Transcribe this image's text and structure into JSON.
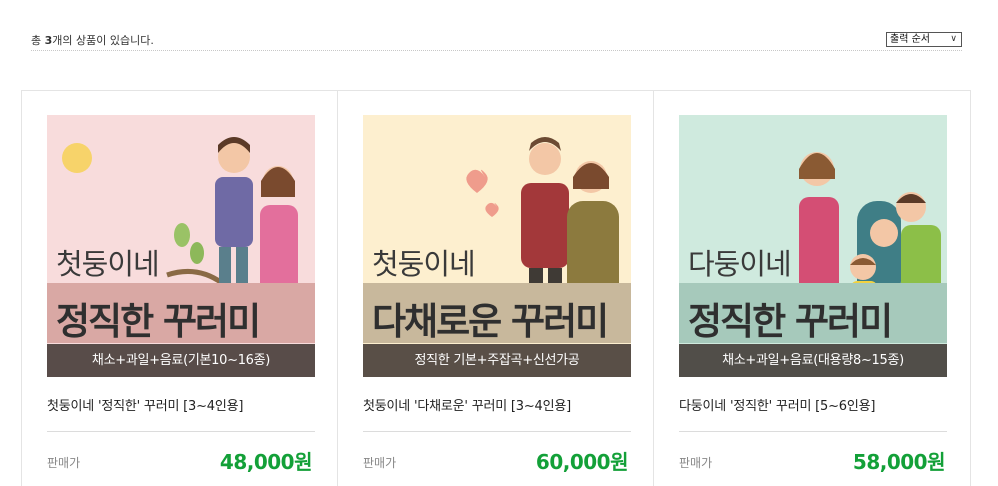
{
  "header": {
    "count_prefix": "총 ",
    "count": "3",
    "count_suffix": "개의 상품이 있습니다.",
    "sort_label": "출력 순서"
  },
  "products": [
    {
      "brand": "첫둥이네",
      "headline": "정직한 꾸러미",
      "caption": "채소+과일+음료(기본10~16종)",
      "name": "첫둥이네 '정직한' 꾸러미 [3~4인용]",
      "price_label": "판매가",
      "price": "48,000원",
      "bg_color": "#f8dcdc",
      "band_color": "#d9a8a4"
    },
    {
      "brand": "첫둥이네",
      "headline": "다채로운 꾸러미",
      "caption": "정직한 기본+주잡곡+신선가공",
      "name": "첫둥이네 '다채로운' 꾸러미 [3~4인용]",
      "price_label": "판매가",
      "price": "60,000원",
      "bg_color": "#fdefcf",
      "band_color": "#c8b89c"
    },
    {
      "brand": "다둥이네",
      "headline": "정직한 꾸러미",
      "caption": "채소+과일+음료(대용량8~15종)",
      "name": "다둥이네 '정직한' 꾸러미 [5~6인용]",
      "price_label": "판매가",
      "price": "58,000원",
      "bg_color": "#cfeade",
      "band_color": "#a6c9bb"
    }
  ],
  "colors": {
    "price_green": "#13a038",
    "caption_bg": "#342c28"
  }
}
